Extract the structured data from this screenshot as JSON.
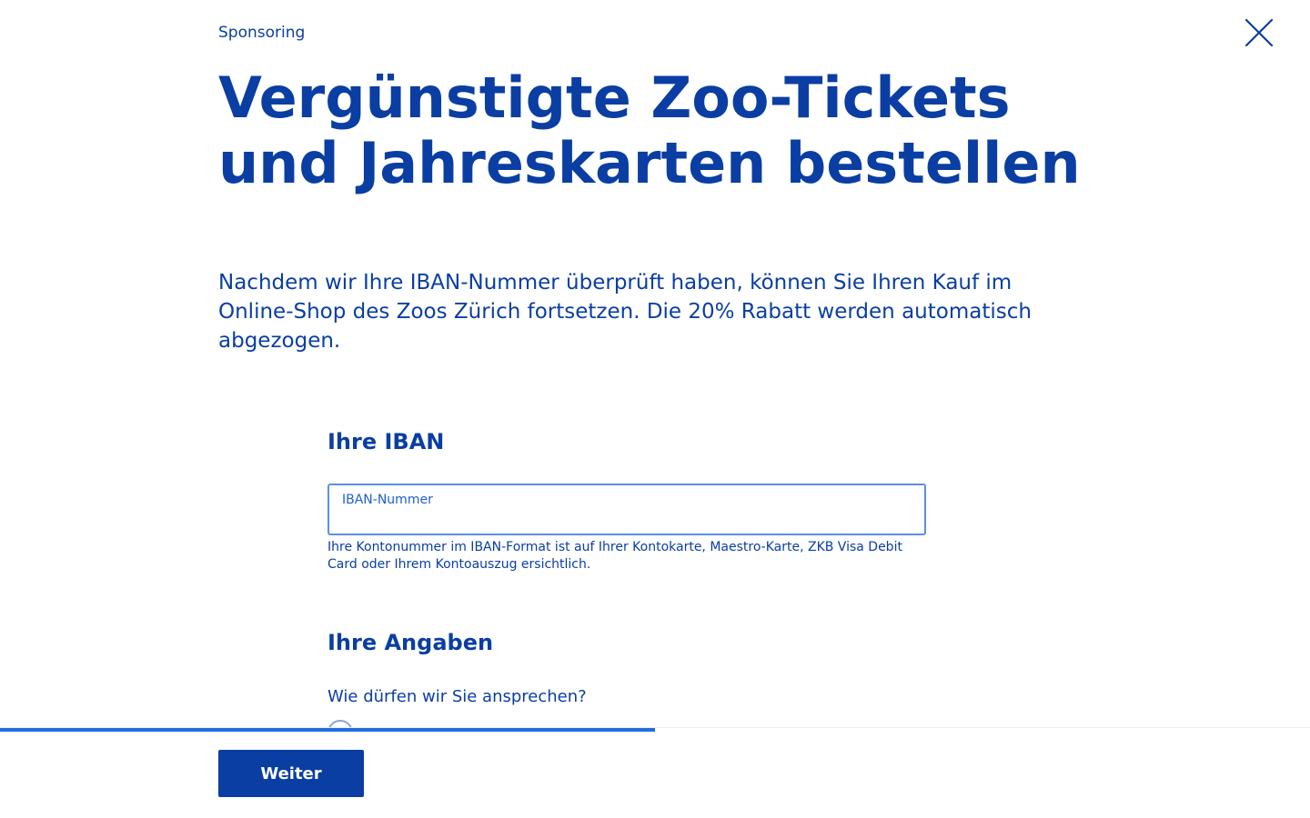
{
  "header": {
    "eyebrow": "Sponsoring",
    "close_icon": "close-icon"
  },
  "main": {
    "title": "Vergünstigte Zoo-Tickets und Jahreskarten bestellen",
    "lead": "Nachdem wir Ihre IBAN-Nummer überprüft haben, können Sie Ihren Kauf im Online-Shop des Zoos Zürich fortsetzen. Die 20% Rabatt werden automatisch abgezogen."
  },
  "iban_section": {
    "heading": "Ihre IBAN",
    "field_label": "IBAN-Nummer",
    "field_value": "",
    "hint": "Ihre Kontonummer im IBAN-Format ist auf Ihrer Kontokarte, Maestro-Karte, ZKB Visa Debit Card oder Ihrem Kontoauszug ersichtlich."
  },
  "details_section": {
    "heading": "Ihre Angaben",
    "salutation_question": "Wie dürfen wir Sie ansprechen?"
  },
  "footer": {
    "progress_fraction": 0.5,
    "next_label": "Weiter"
  },
  "colors": {
    "brand": "#0a3ea3",
    "accent": "#1f6fe0",
    "field_border": "#5b8fe6"
  }
}
